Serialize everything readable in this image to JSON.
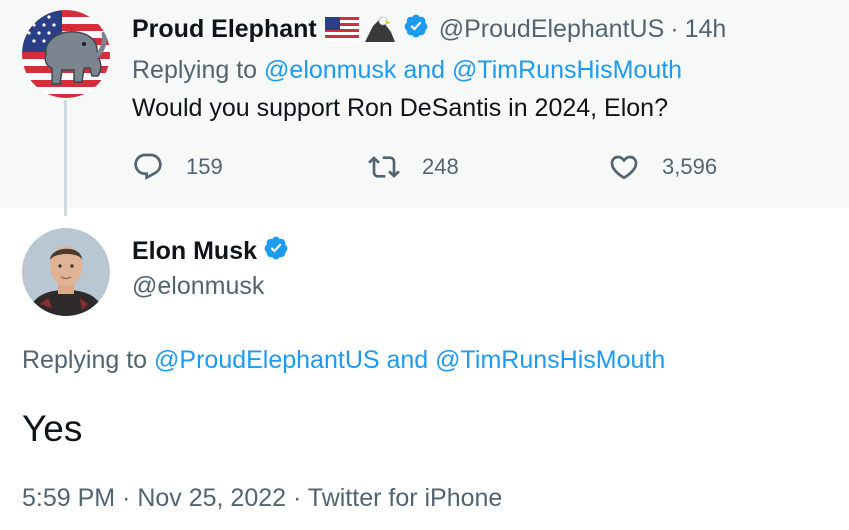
{
  "parent_tweet": {
    "display_name": "Proud Elephant",
    "name_emojis": [
      "flag-usa",
      "eagle"
    ],
    "verified": true,
    "handle": "@ProudElephantUS",
    "separator": "·",
    "time": "14h",
    "replying_prefix": "Replying to",
    "replying_mention_1": "@elonmusk",
    "replying_and": "and",
    "replying_mention_2": "@TimRunsHisMouth",
    "text": "Would you support Ron DeSantis in 2024, Elon?",
    "reply_count": "159",
    "retweet_count": "248",
    "like_count": "3,596"
  },
  "main_tweet": {
    "display_name": "Elon Musk",
    "verified": true,
    "handle": "@elonmusk",
    "replying_prefix": "Replying to",
    "replying_mention_1": "@ProudElephantUS",
    "replying_and": "and",
    "replying_mention_2": "@TimRunsHisMouth",
    "text": "Yes",
    "timestamp": "5:59 PM · Nov 25, 2022 · Twitter for iPhone"
  },
  "colors": {
    "accent": "#1d9bf0",
    "text_primary": "#0f1419",
    "text_secondary": "#536471",
    "parent_background": "#f7f9f9",
    "thread_line": "#cfd9de"
  },
  "icons": {
    "reply": "reply-bubble-icon",
    "retweet": "retweet-icon",
    "like": "heart-icon",
    "verified": "verified-badge-icon"
  }
}
